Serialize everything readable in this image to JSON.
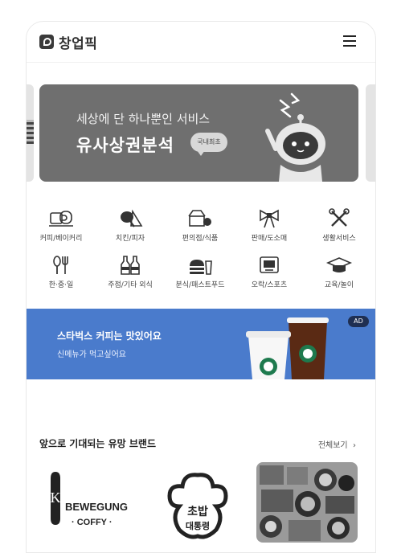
{
  "header": {
    "logo_text": "창업픽",
    "menu_icon": "hamburger-menu-icon"
  },
  "banner": {
    "subtitle": "세상에 단 하나뿐인 서비스",
    "title": "유사상권분석",
    "badge": "국내최초",
    "colors": {
      "background": "#6f6f6f",
      "text": "#ffffff"
    }
  },
  "categories": [
    {
      "label": "커피/베이커리",
      "icon": "coffee-bread-icon"
    },
    {
      "label": "치킨/피자",
      "icon": "chicken-pizza-icon"
    },
    {
      "label": "편의점/식품",
      "icon": "convenience-store-icon"
    },
    {
      "label": "판매/도소매",
      "icon": "gift-bow-icon"
    },
    {
      "label": "생활서비스",
      "icon": "tools-icon"
    },
    {
      "label": "한·중·일",
      "icon": "spoon-fork-icon"
    },
    {
      "label": "주점/기타 외식",
      "icon": "bottles-icon"
    },
    {
      "label": "분식/패스트푸드",
      "icon": "burger-drink-icon"
    },
    {
      "label": "오락/스포츠",
      "icon": "game-monitor-icon"
    },
    {
      "label": "교육/놀이",
      "icon": "graduation-cap-icon"
    }
  ],
  "ad": {
    "title": "스타벅스 커피는 맛있어요",
    "subtitle": "신메뉴가 먹고싶어요",
    "badge": "AD",
    "colors": {
      "background": "#4a7bcc"
    }
  },
  "brands_section": {
    "title": "앞으로 기대되는 유망 브랜드",
    "see_all": "전체보기",
    "brands": [
      {
        "logo_text": "BEWEGUNG",
        "logo_text_2": "· COFFY ·"
      },
      {
        "logo_text": "초밥",
        "logo_text_2": "대통령"
      },
      {
        "logo_text": ""
      }
    ]
  }
}
